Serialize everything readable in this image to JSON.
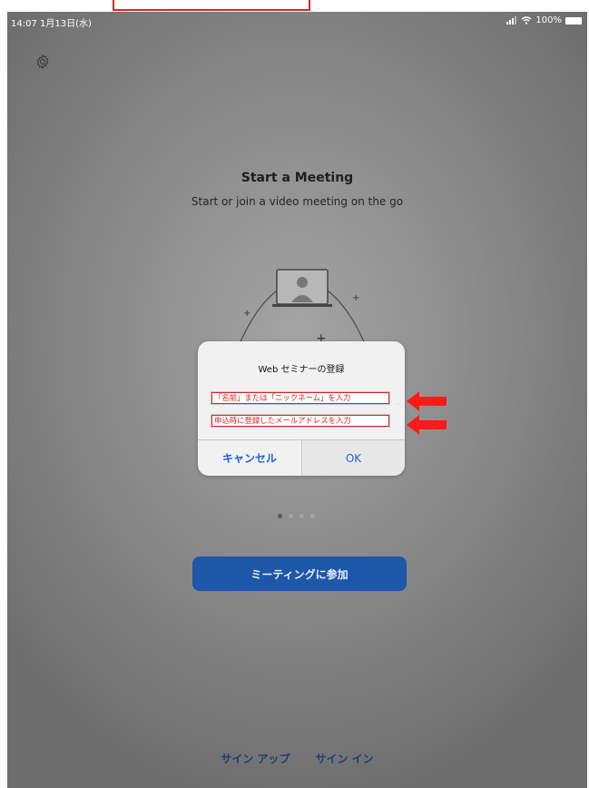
{
  "status_bar": {
    "time": "14:07  1月13日(水)",
    "battery": "100%"
  },
  "main": {
    "title": "Start a Meeting",
    "subtitle": "Start or join a video meeting on the go",
    "page_indicator": {
      "count": 4,
      "active": 1
    },
    "join_button": "ミーティングに参加",
    "sign_up": "サイン アップ",
    "sign_in": "サイン イン"
  },
  "dialog": {
    "title": "Web セミナーの登録",
    "field_name_annotation": "「名前」または「ニックネーム」を入力",
    "field_email_annotation": "申込時に登録したメールアドレスを入力",
    "cancel": "キャンセル",
    "ok": "OK"
  },
  "colors": {
    "accent": "#1a65d6",
    "join_button_bg": "#1e56a8",
    "annotation_red": "#e0241c"
  },
  "icons": [
    "settings-gear-icon",
    "wifi-icon",
    "signal-icon",
    "battery-icon",
    "arrow-left-icon"
  ]
}
